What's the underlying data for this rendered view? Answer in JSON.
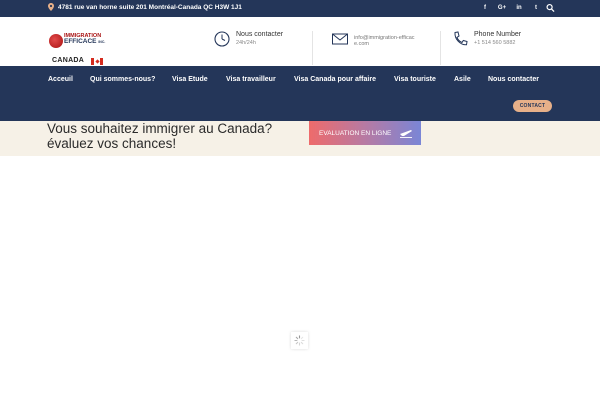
{
  "topbar": {
    "address": "4781 rue van horne suite 201 Montréal-Canada QC H3W 1J1",
    "socials": [
      {
        "icon": "facebook-icon",
        "glyph": "f"
      },
      {
        "icon": "google-plus-icon",
        "glyph": "G+"
      },
      {
        "icon": "linkedin-icon",
        "glyph": "in"
      },
      {
        "icon": "twitter-icon",
        "glyph": "t"
      }
    ]
  },
  "header": {
    "logo_line1": "IMMIGRATION",
    "logo_line2": "EFFICACE",
    "logo_suffix": "INC.",
    "country": "CANADA",
    "contact_hours": {
      "title": "Nous contacter",
      "value": "24h/24h"
    },
    "email": {
      "value": "info@immigration-efficace.com"
    },
    "phone": {
      "title": "Phone Number",
      "value": "+1 514 560 5882"
    }
  },
  "nav": {
    "items": [
      "Acceuil",
      "Qui sommes-nous?",
      "Visa Etude",
      "Visa travailleur",
      "Visa Canada pour affaire",
      "Visa touriste",
      "Asile",
      "Nous contacter"
    ],
    "contact_button": "CONTACT"
  },
  "hero": {
    "title_line1": "Vous souhaitez immigrer au Canada?",
    "title_line2": "évaluez vos chances!",
    "eval_button": "EVALUATION EN LIGNE"
  },
  "colors": {
    "navy": "#243659",
    "accent_button": "#e7b089",
    "hero_bg": "#f6f1e7",
    "logo_red": "#a81212"
  }
}
